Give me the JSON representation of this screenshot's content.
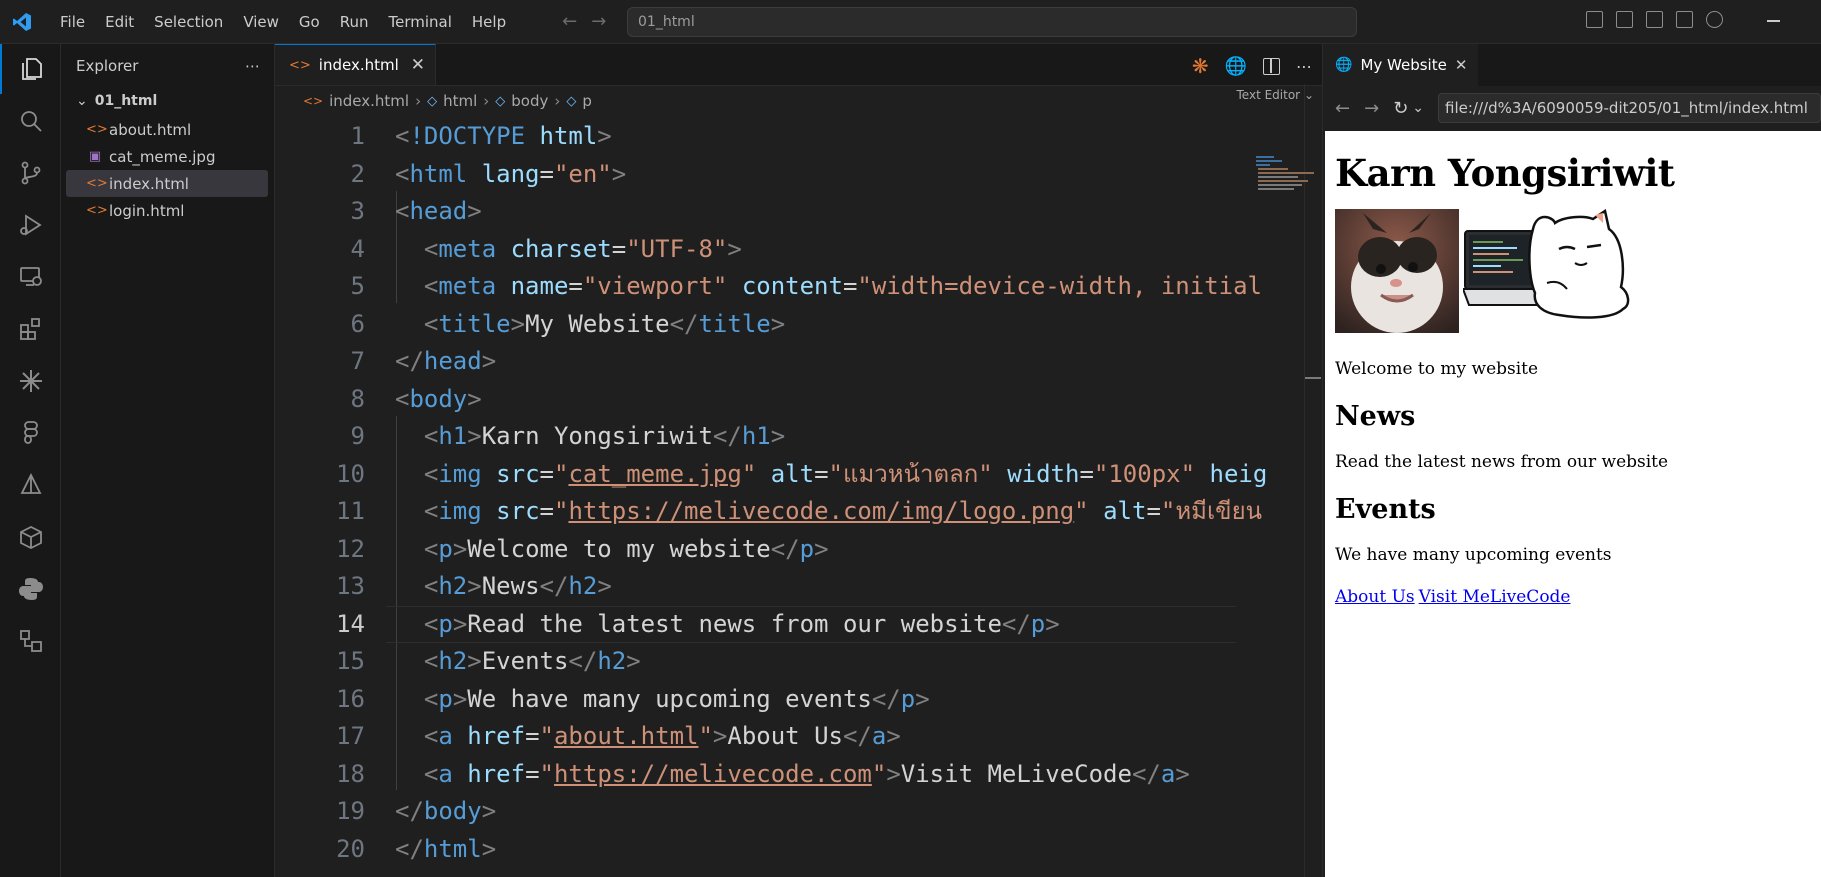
{
  "titlebar": {
    "menu": [
      "File",
      "Edit",
      "Selection",
      "View",
      "Go",
      "Run",
      "Terminal",
      "Help"
    ],
    "search_text": "01_html"
  },
  "activitybar": {
    "icons": [
      "explorer-icon",
      "search-icon",
      "source-control-icon",
      "run-debug-icon",
      "remote-explorer-icon",
      "extensions-icon",
      "sparkle-icon",
      "figma-icon",
      "deploy-icon",
      "package-icon",
      "python-icon",
      "shapes-icon"
    ]
  },
  "sidebar": {
    "title": "Explorer",
    "more": "⋯",
    "folder": "01_html",
    "files": [
      {
        "name": "about.html",
        "type": "html"
      },
      {
        "name": "cat_meme.jpg",
        "type": "image"
      },
      {
        "name": "index.html",
        "type": "html"
      },
      {
        "name": "login.html",
        "type": "html"
      }
    ]
  },
  "editor": {
    "tab_label": "index.html",
    "breadcrumb": [
      "index.html",
      "html",
      "body",
      "p"
    ],
    "text_editor_label": "Text Editor",
    "current_line": 14,
    "lines": [
      "<!DOCTYPE html>",
      "<html lang=\"en\">",
      "<head>",
      "  <meta charset=\"UTF-8\">",
      "  <meta name=\"viewport\" content=\"width=device-width, initial",
      "  <title>My Website</title>",
      "</head>",
      "<body>",
      "  <h1>Karn Yongsiriwit</h1>",
      "  <img src=\"cat_meme.jpg\" alt=\"แมวหน้าตลก\" width=\"100px\" heig",
      "  <img src=\"https://melivecode.com/img/logo.png\" alt=\"หมีเขียน",
      "  <p>Welcome to my website</p>",
      "  <h2>News</h2>",
      "  <p>Read the latest news from our website</p>",
      "  <h2>Events</h2>",
      "  <p>We have many upcoming events</p>",
      "  <a href=\"about.html\">About Us</a>",
      "  <a href=\"https://melivecode.com\">Visit MeLiveCode</a>",
      "</body>",
      "</html>"
    ]
  },
  "preview": {
    "tab_label": "My Website",
    "url": "file:///d%3A/6090059-dit205/01_html/index.html",
    "page": {
      "h1": "Karn Yongsiriwit",
      "welcome": "Welcome to my website",
      "news_heading": "News",
      "news_text": "Read the latest news from our website",
      "events_heading": "Events",
      "events_text": "We have many upcoming events",
      "link_about": "About Us",
      "link_visit": "Visit MeLiveCode"
    }
  },
  "colors": {
    "accent": "#0078d4",
    "tag": "#569cd6",
    "attribute": "#9cdcfe",
    "string": "#ce9178",
    "link": "#0000ee"
  }
}
